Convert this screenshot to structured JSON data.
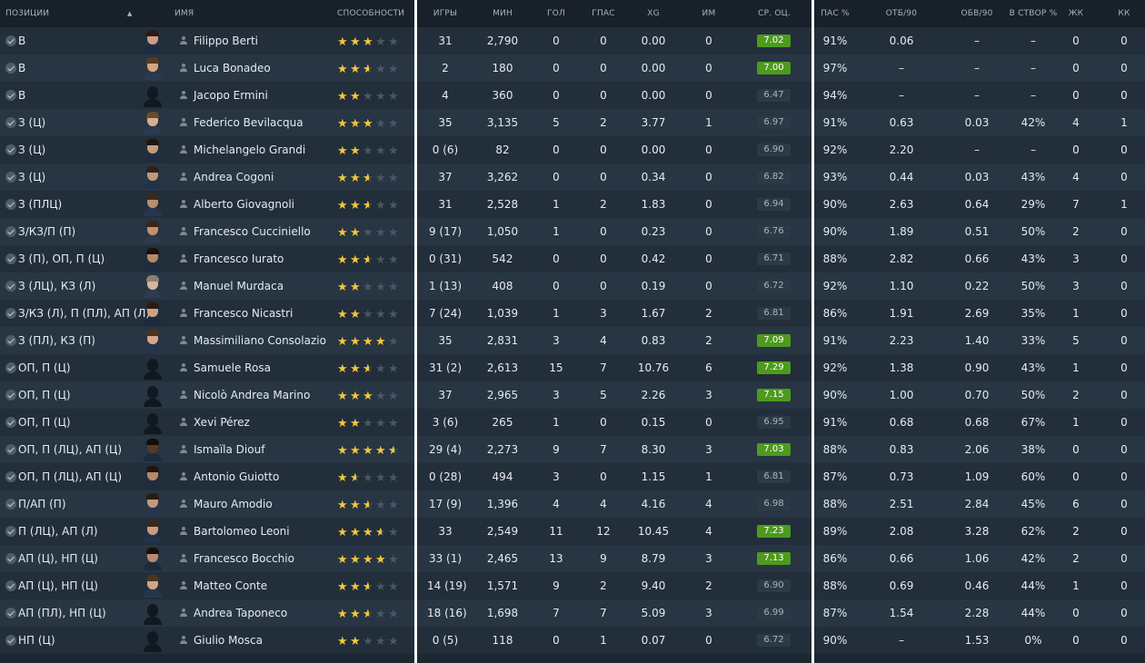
{
  "colors": {
    "good_rating": "#4d9a1e",
    "star": "#f3c73b",
    "separator": "#ffffff"
  },
  "columns": {
    "positions": "ПОЗИЦИИ",
    "name": "ИМЯ",
    "ability": "СПОСОБНОСТИ",
    "apps": "ИГРЫ",
    "mins": "МИН",
    "goals": "ГОЛ",
    "assists": "ГПАС",
    "xg": "XG",
    "pom": "ИМ",
    "avg_rating": "СР. ОЦ.",
    "pass_pct": "ПАС %",
    "tackles_90": "ОТБ/90",
    "dribbles_90": "ОБВ/90",
    "shots_on_target_pct": "В СТВОР %",
    "yellow": "ЖК",
    "red": "КК"
  },
  "sort_indicator": "▲",
  "players": [
    {
      "pos": "В",
      "name": "Filippo Berti",
      "stars": 3,
      "apps": "31",
      "mins": "2,790",
      "gls": "0",
      "ast": "0",
      "xg": "0.00",
      "pom": "0",
      "rating": "7.02",
      "good": true,
      "pass": "91%",
      "tck": "0.06",
      "drb": "–",
      "sot": "–",
      "yel": "0",
      "red": "0",
      "photo": "face",
      "skin": "#c99e82",
      "hair": "#2a1a12",
      "shirt": "#1c2b45"
    },
    {
      "pos": "В",
      "name": "Luca Bonadeo",
      "stars": 2.5,
      "apps": "2",
      "mins": "180",
      "gls": "0",
      "ast": "0",
      "xg": "0.00",
      "pom": "0",
      "rating": "7.00",
      "good": true,
      "pass": "97%",
      "tck": "–",
      "drb": "–",
      "sot": "–",
      "yel": "0",
      "red": "0",
      "photo": "face",
      "skin": "#d3a47e",
      "hair": "#5a3a1e",
      "shirt": "#2a3a50"
    },
    {
      "pos": "В",
      "name": "Jacopo Ermini",
      "stars": 2,
      "apps": "4",
      "mins": "360",
      "gls": "0",
      "ast": "0",
      "xg": "0.00",
      "pom": "0",
      "rating": "6.47",
      "good": false,
      "pass": "94%",
      "tck": "–",
      "drb": "–",
      "sot": "–",
      "yel": "0",
      "red": "0",
      "photo": "sil"
    },
    {
      "pos": "З (Ц)",
      "name": "Federico Bevilacqua",
      "stars": 3,
      "apps": "35",
      "mins": "3,135",
      "gls": "5",
      "ast": "2",
      "xg": "3.77",
      "pom": "1",
      "rating": "6.97",
      "good": false,
      "pass": "91%",
      "tck": "0.63",
      "drb": "0.03",
      "sot": "42%",
      "yel": "4",
      "red": "1",
      "photo": "face",
      "skin": "#d9ad90",
      "hair": "#6b4a2c",
      "shirt": "#283a52"
    },
    {
      "pos": "З (Ц)",
      "name": "Michelangelo Grandi",
      "stars": 2,
      "apps": "0 (6)",
      "mins": "82",
      "gls": "0",
      "ast": "0",
      "xg": "0.00",
      "pom": "0",
      "rating": "6.90",
      "good": false,
      "pass": "92%",
      "tck": "2.20",
      "drb": "–",
      "sot": "–",
      "yel": "0",
      "red": "0",
      "photo": "face",
      "skin": "#c89a7c",
      "hair": "#1f1611",
      "shirt": "#1f2c40"
    },
    {
      "pos": "З (Ц)",
      "name": "Andrea Cogoni",
      "stars": 2.5,
      "apps": "37",
      "mins": "3,262",
      "gls": "0",
      "ast": "0",
      "xg": "0.34",
      "pom": "0",
      "rating": "6.82",
      "good": false,
      "pass": "93%",
      "tck": "0.44",
      "drb": "0.03",
      "sot": "43%",
      "yel": "4",
      "red": "0",
      "photo": "face",
      "skin": "#c3977a",
      "hair": "#2e2018",
      "shirt": "#223248"
    },
    {
      "pos": "З (ПЛЦ)",
      "name": "Alberto Giovagnoli",
      "stars": 2.5,
      "apps": "31",
      "mins": "2,528",
      "gls": "1",
      "ast": "2",
      "xg": "1.83",
      "pom": "0",
      "rating": "6.94",
      "good": false,
      "pass": "90%",
      "tck": "2.63",
      "drb": "0.64",
      "sot": "29%",
      "yel": "7",
      "red": "1",
      "photo": "face",
      "skin": "#b88d70",
      "hair": "#3a2a1e",
      "shirt": "#26364c"
    },
    {
      "pos": "З/КЗ/П (П)",
      "name": "Francesco Cucciniello",
      "stars": 2,
      "apps": "9 (17)",
      "mins": "1,050",
      "gls": "1",
      "ast": "0",
      "xg": "0.23",
      "pom": "0",
      "rating": "6.76",
      "good": false,
      "pass": "90%",
      "tck": "1.89",
      "drb": "0.51",
      "sot": "50%",
      "yel": "2",
      "red": "0",
      "photo": "face",
      "skin": "#c49070",
      "hair": "#3b2516",
      "shirt": "#2a3a50"
    },
    {
      "pos": "З (П), ОП, П (Ц)",
      "name": "Francesco Iurato",
      "stars": 2.5,
      "apps": "0 (31)",
      "mins": "542",
      "gls": "0",
      "ast": "0",
      "xg": "0.42",
      "pom": "0",
      "rating": "6.71",
      "good": false,
      "pass": "88%",
      "tck": "2.82",
      "drb": "0.66",
      "sot": "43%",
      "yel": "3",
      "red": "0",
      "photo": "face",
      "skin": "#b9886a",
      "hair": "#1a120d",
      "shirt": "#1e2c40"
    },
    {
      "pos": "З (ЛЦ), КЗ (Л)",
      "name": "Manuel Murdaca",
      "stars": 2,
      "apps": "1 (13)",
      "mins": "408",
      "gls": "0",
      "ast": "0",
      "xg": "0.19",
      "pom": "0",
      "rating": "6.72",
      "good": false,
      "pass": "92%",
      "tck": "1.10",
      "drb": "0.22",
      "sot": "50%",
      "yel": "3",
      "red": "0",
      "photo": "face",
      "skin": "#d8b49a",
      "hair": "#8a8070",
      "shirt": "#2c3c52"
    },
    {
      "pos": "З/КЗ (Л), П (ПЛ), АП (Л)",
      "name": "Francesco Nicastri",
      "stars": 2,
      "apps": "7 (24)",
      "mins": "1,039",
      "gls": "1",
      "ast": "3",
      "xg": "1.67",
      "pom": "2",
      "rating": "6.81",
      "good": false,
      "pass": "86%",
      "tck": "1.91",
      "drb": "2.69",
      "sot": "35%",
      "yel": "1",
      "red": "0",
      "photo": "face",
      "skin": "#d0a282",
      "hair": "#2b1c12",
      "shirt": "#1c2a3e"
    },
    {
      "pos": "З (ПЛ), КЗ (П)",
      "name": "Massimiliano Consolazio",
      "stars": 4,
      "apps": "35",
      "mins": "2,831",
      "gls": "3",
      "ast": "4",
      "xg": "0.83",
      "pom": "2",
      "rating": "7.09",
      "good": true,
      "pass": "91%",
      "tck": "2.23",
      "drb": "1.40",
      "sot": "33%",
      "yel": "5",
      "red": "0",
      "photo": "face",
      "skin": "#d4a88a",
      "hair": "#4a3422",
      "shirt": "#24344a"
    },
    {
      "pos": "ОП, П (Ц)",
      "name": "Samuele Rosa",
      "stars": 2.5,
      "apps": "31 (2)",
      "mins": "2,613",
      "gls": "15",
      "ast": "7",
      "xg": "10.76",
      "pom": "6",
      "rating": "7.29",
      "good": true,
      "pass": "92%",
      "tck": "1.38",
      "drb": "0.90",
      "sot": "43%",
      "yel": "1",
      "red": "0",
      "photo": "sil"
    },
    {
      "pos": "ОП, П (Ц)",
      "name": "Nicolò Andrea Marino",
      "stars": 3,
      "apps": "37",
      "mins": "2,965",
      "gls": "3",
      "ast": "5",
      "xg": "2.26",
      "pom": "3",
      "rating": "7.15",
      "good": true,
      "pass": "90%",
      "tck": "1.00",
      "drb": "0.70",
      "sot": "50%",
      "yel": "2",
      "red": "0",
      "photo": "sil"
    },
    {
      "pos": "ОП, П (Ц)",
      "name": "Xevi Pérez",
      "stars": 2,
      "apps": "3 (6)",
      "mins": "265",
      "gls": "1",
      "ast": "0",
      "xg": "0.15",
      "pom": "0",
      "rating": "6.95",
      "good": false,
      "pass": "91%",
      "tck": "0.68",
      "drb": "0.68",
      "sot": "67%",
      "yel": "1",
      "red": "0",
      "photo": "sil"
    },
    {
      "pos": "ОП, П (ЛЦ), АП (Ц)",
      "name": "Ismaïla Diouf",
      "stars": 4.5,
      "apps": "29 (4)",
      "mins": "2,273",
      "gls": "9",
      "ast": "7",
      "xg": "8.30",
      "pom": "3",
      "rating": "7.03",
      "good": true,
      "pass": "88%",
      "tck": "0.83",
      "drb": "2.06",
      "sot": "38%",
      "yel": "0",
      "red": "0",
      "photo": "face",
      "skin": "#5a3826",
      "hair": "#140d09",
      "shirt": "#1c2a3e"
    },
    {
      "pos": "ОП, П (ЛЦ), АП (Ц)",
      "name": "Antonio Guiotto",
      "stars": 1.5,
      "apps": "0 (28)",
      "mins": "494",
      "gls": "3",
      "ast": "0",
      "xg": "1.15",
      "pom": "1",
      "rating": "6.81",
      "good": false,
      "pass": "87%",
      "tck": "0.73",
      "drb": "1.09",
      "sot": "60%",
      "yel": "0",
      "red": "0",
      "photo": "face",
      "skin": "#b8896c",
      "hair": "#20160f",
      "shirt": "#1e2c40"
    },
    {
      "pos": "П/АП (П)",
      "name": "Mauro Amodio",
      "stars": 2.5,
      "apps": "17 (9)",
      "mins": "1,396",
      "gls": "4",
      "ast": "4",
      "xg": "4.16",
      "pom": "4",
      "rating": "6.98",
      "good": false,
      "pass": "88%",
      "tck": "2.51",
      "drb": "2.84",
      "sot": "45%",
      "yel": "6",
      "red": "0",
      "photo": "face",
      "skin": "#c4987c",
      "hair": "#2a1c13",
      "shirt": "#24344a"
    },
    {
      "pos": "П (ЛЦ), АП (Л)",
      "name": "Bartolomeo Leoni",
      "stars": 3.5,
      "apps": "33",
      "mins": "2,549",
      "gls": "11",
      "ast": "12",
      "xg": "10.45",
      "pom": "4",
      "rating": "7.23",
      "good": true,
      "pass": "89%",
      "tck": "2.08",
      "drb": "3.28",
      "sot": "62%",
      "yel": "2",
      "red": "0",
      "photo": "face",
      "skin": "#c99c80",
      "hair": "#3a281b",
      "shirt": "#22324a"
    },
    {
      "pos": "АП (Ц), НП (Ц)",
      "name": "Francesco Bocchio",
      "stars": 4,
      "apps": "33 (1)",
      "mins": "2,465",
      "gls": "13",
      "ast": "9",
      "xg": "8.79",
      "pom": "3",
      "rating": "7.13",
      "good": true,
      "pass": "86%",
      "tck": "0.66",
      "drb": "1.06",
      "sot": "42%",
      "yel": "2",
      "red": "0",
      "photo": "face",
      "skin": "#b78a6e",
      "hair": "#181009",
      "shirt": "#1c2a3e"
    },
    {
      "pos": "АП (Ц), НП (Ц)",
      "name": "Matteo Conte",
      "stars": 2.5,
      "apps": "14 (19)",
      "mins": "1,571",
      "gls": "9",
      "ast": "2",
      "xg": "9.40",
      "pom": "2",
      "rating": "6.90",
      "good": false,
      "pass": "88%",
      "tck": "0.69",
      "drb": "0.46",
      "sot": "44%",
      "yel": "1",
      "red": "0",
      "photo": "face",
      "skin": "#d1a589",
      "hair": "#4a3525",
      "shirt": "#26364c"
    },
    {
      "pos": "АП (ПЛ), НП (Ц)",
      "name": "Andrea Taponeco",
      "stars": 2.5,
      "apps": "18 (16)",
      "mins": "1,698",
      "gls": "7",
      "ast": "7",
      "xg": "5.09",
      "pom": "3",
      "rating": "6.99",
      "good": false,
      "pass": "87%",
      "tck": "1.54",
      "drb": "2.28",
      "sot": "44%",
      "yel": "0",
      "red": "0",
      "photo": "sil"
    },
    {
      "pos": "НП (Ц)",
      "name": "Giulio Mosca",
      "stars": 2,
      "apps": "0 (5)",
      "mins": "118",
      "gls": "0",
      "ast": "1",
      "xg": "0.07",
      "pom": "0",
      "rating": "6.72",
      "good": false,
      "pass": "90%",
      "tck": "–",
      "drb": "1.53",
      "sot": "0%",
      "yel": "0",
      "red": "0",
      "photo": "sil"
    }
  ]
}
